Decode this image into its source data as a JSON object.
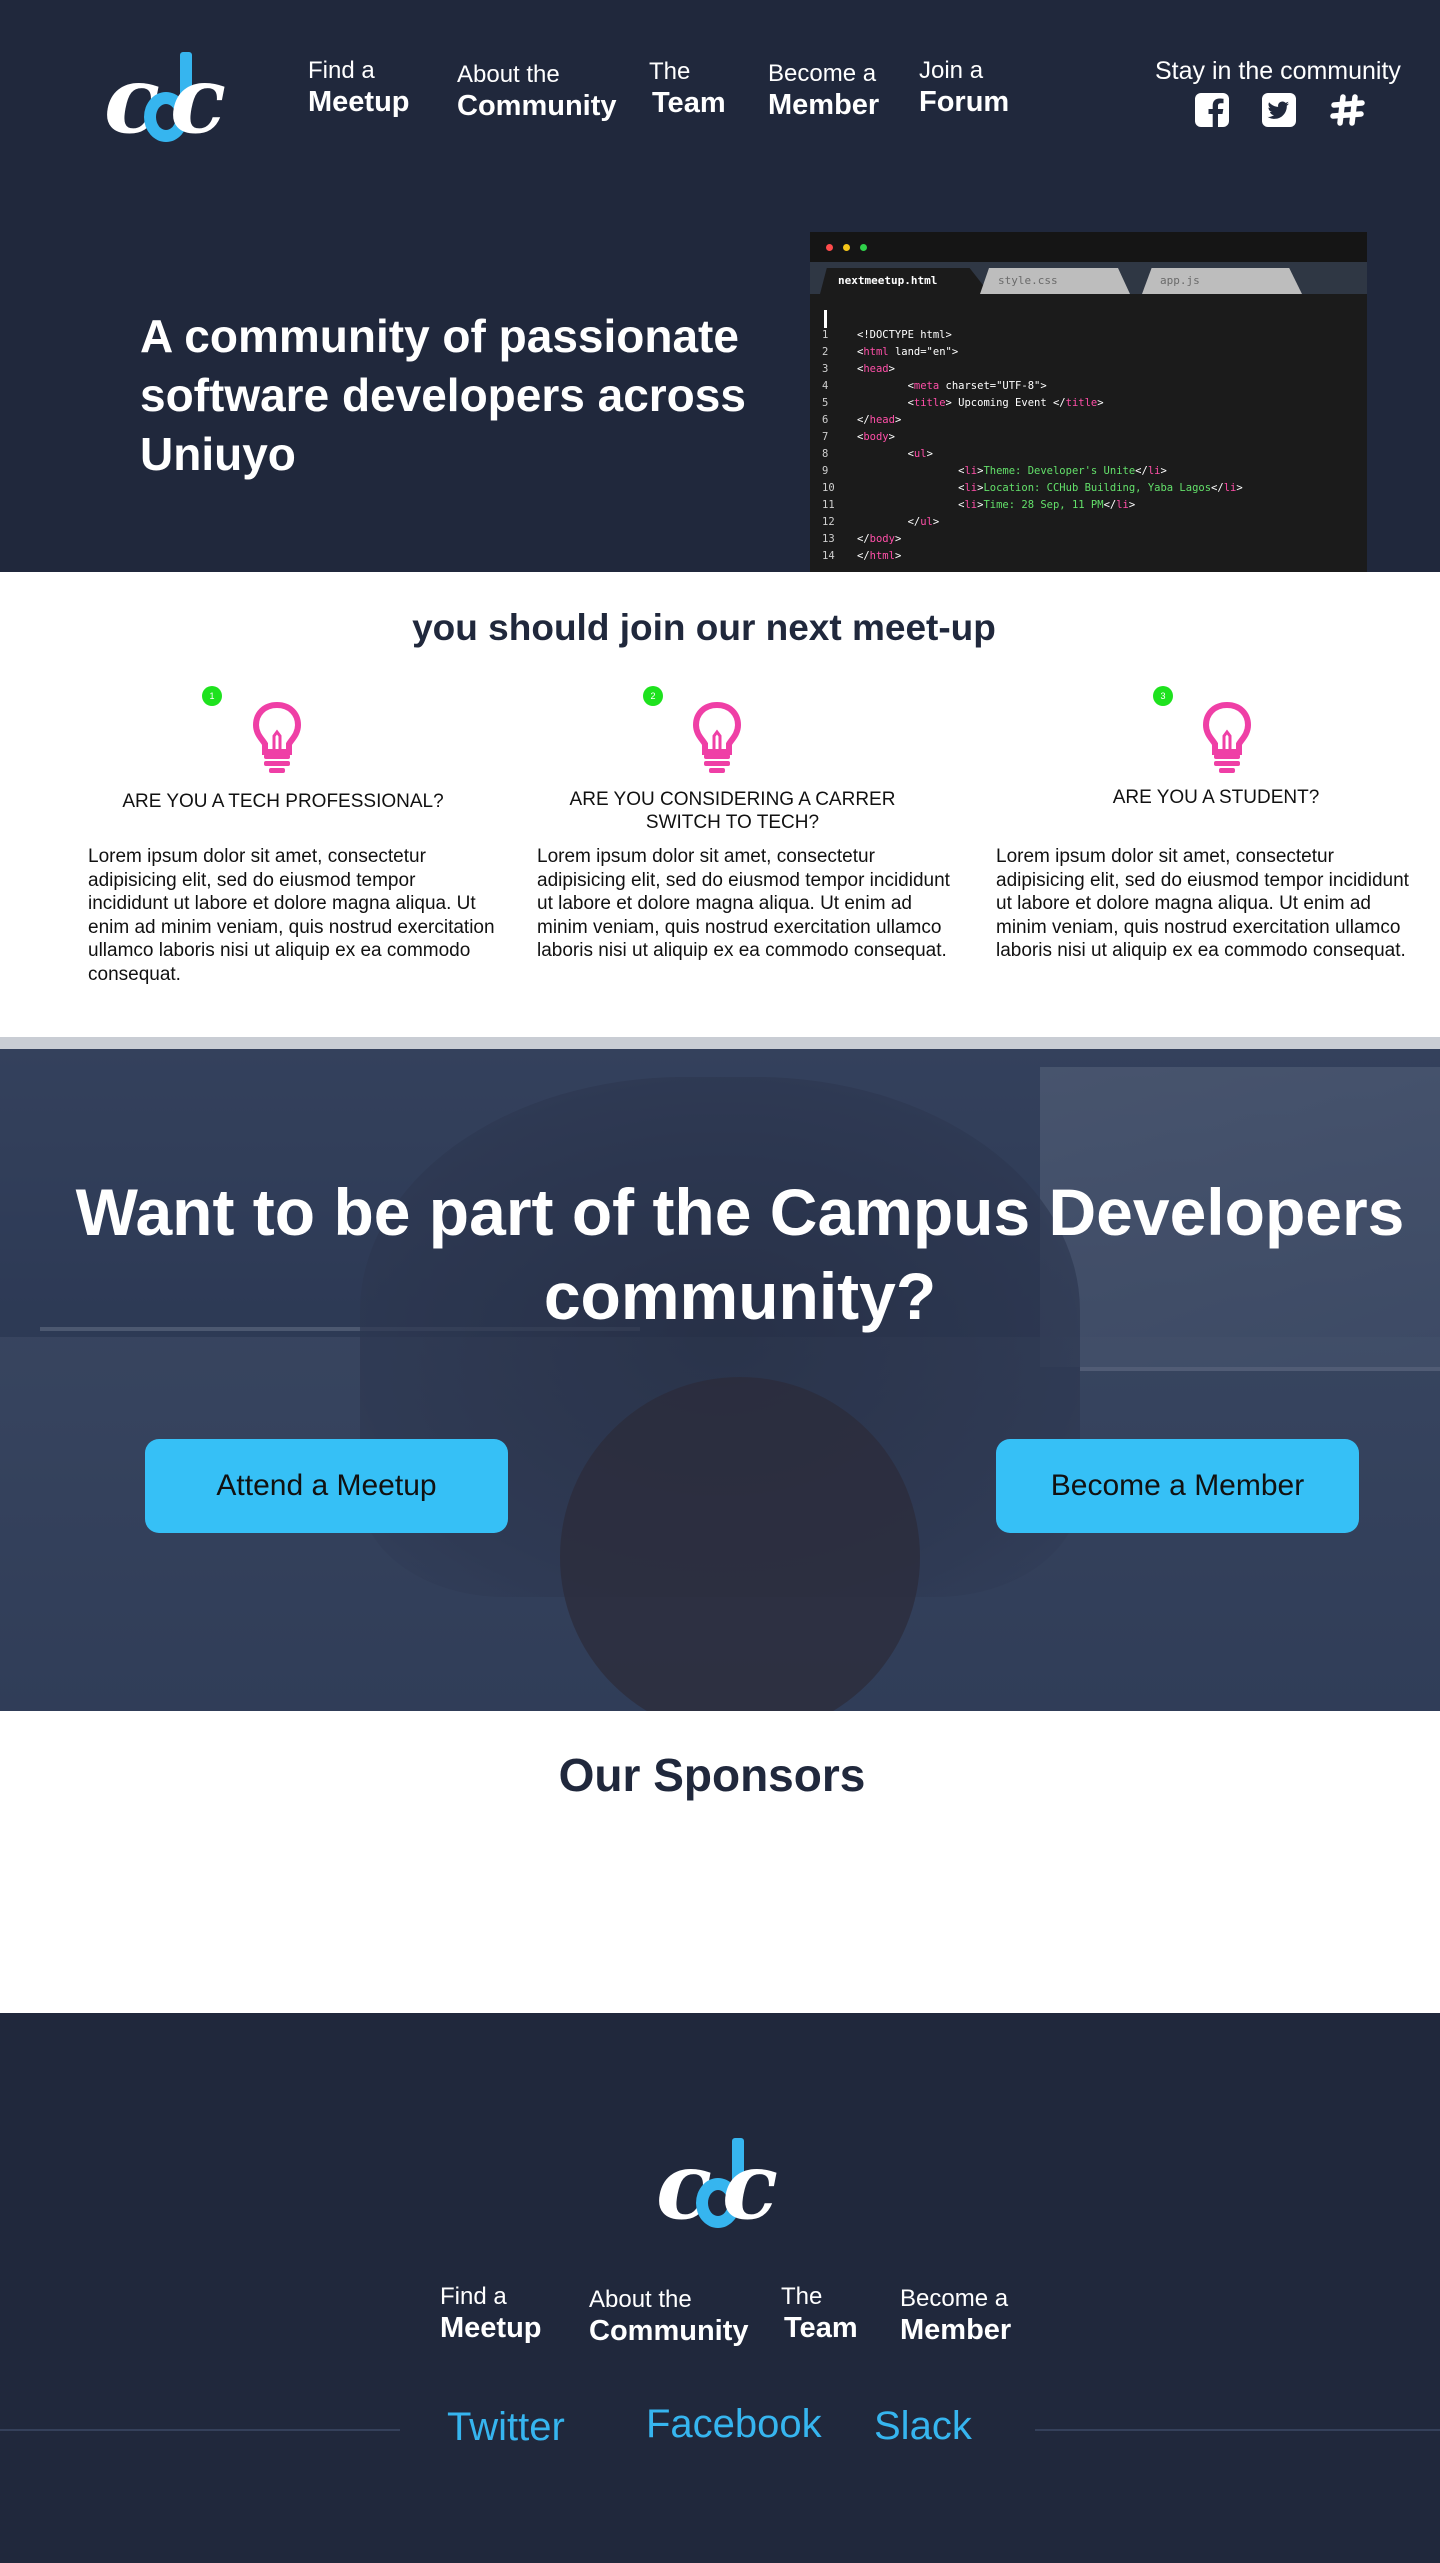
{
  "header": {
    "nav": [
      {
        "line1": "Find a",
        "line2": "Meetup"
      },
      {
        "line1": "About the",
        "line2": "Community"
      },
      {
        "line1": "The",
        "line2": "Team"
      },
      {
        "line1": "Become a",
        "line2": "Member"
      },
      {
        "line1": "Join a",
        "line2": "Forum"
      }
    ],
    "stay_label": "Stay in the community",
    "social_icons": [
      "facebook-icon",
      "twitter-icon",
      "slack-icon"
    ]
  },
  "hero": {
    "title": "A community of passionate software developers across Uniuyo"
  },
  "editor": {
    "tabs": [
      "nextmeetup.html",
      "style.css",
      "app.js"
    ],
    "lines": [
      {
        "n": "1",
        "text": "<!DOCTYPE html>"
      },
      {
        "n": "2",
        "text": "<html land=\"en\">"
      },
      {
        "n": "3",
        "text": "<head>"
      },
      {
        "n": "4",
        "text": "        <meta charset=\"UTF-8\">"
      },
      {
        "n": "5",
        "text": "        <title> Upcoming Event </title>"
      },
      {
        "n": "6",
        "text": "</head>"
      },
      {
        "n": "7",
        "text": "<body>"
      },
      {
        "n": "8",
        "text": "        <ul>"
      },
      {
        "n": "9",
        "text": "                <li>Theme: Developer's Unite</li>"
      },
      {
        "n": "10",
        "text": "                <li>Location: CCHub Building, Yaba Lagos</li>"
      },
      {
        "n": "11",
        "text": "                <li>Time: 28 Sep, 11 PM</li>"
      },
      {
        "n": "12",
        "text": "        </ul>"
      },
      {
        "n": "13",
        "text": "</body>"
      },
      {
        "n": "14",
        "text": "</html>"
      }
    ]
  },
  "meetup": {
    "title": "you should join our next meet-up",
    "items": [
      {
        "step": "1",
        "title": "ARE YOU A TECH PROFESSIONAL?",
        "body": "Lorem ipsum dolor sit amet, consectetur adipisicing elit, sed do eiusmod tempor incididunt ut labore et dolore magna aliqua. Ut enim ad minim veniam, quis nostrud exercitation ullamco laboris nisi ut aliquip ex ea commodo consequat."
      },
      {
        "step": "2",
        "title": "ARE YOU CONSIDERING A CARRER SWITCH TO TECH?",
        "body": "Lorem ipsum dolor sit amet, consectetur adipisicing elit, sed do eiusmod tempor incididunt ut labore et dolore magna aliqua. Ut enim ad minim veniam, quis nostrud exercitation ullamco laboris nisi ut aliquip ex ea commodo consequat."
      },
      {
        "step": "3",
        "title": "ARE YOU A STUDENT?",
        "body": "Lorem ipsum dolor sit amet, consectetur adipisicing elit, sed do eiusmod tempor incididunt ut labore et dolore magna aliqua. Ut enim ad minim veniam, quis nostrud exercitation ullamco laboris nisi ut aliquip ex ea commodo consequat."
      }
    ]
  },
  "join": {
    "title": "Want to be part of the Campus Developers community?",
    "attend_label": "Attend a Meetup",
    "member_label": "Become a Member"
  },
  "sponsors": {
    "title": "Our Sponsors"
  },
  "footer": {
    "nav": [
      {
        "line1": "Find a",
        "line2": "Meetup"
      },
      {
        "line1": "About the",
        "line2": "Community"
      },
      {
        "line1": "The",
        "line2": "Team"
      },
      {
        "line1": "Become a",
        "line2": "Member"
      }
    ],
    "links": [
      "Twitter",
      "Facebook",
      "Slack"
    ]
  },
  "colors": {
    "navy": "#20283c",
    "accent_blue": "#36b5ef",
    "button_blue": "#36c0f6",
    "bulb_pink": "#ef3fa6",
    "step_green": "#1ee21e"
  }
}
